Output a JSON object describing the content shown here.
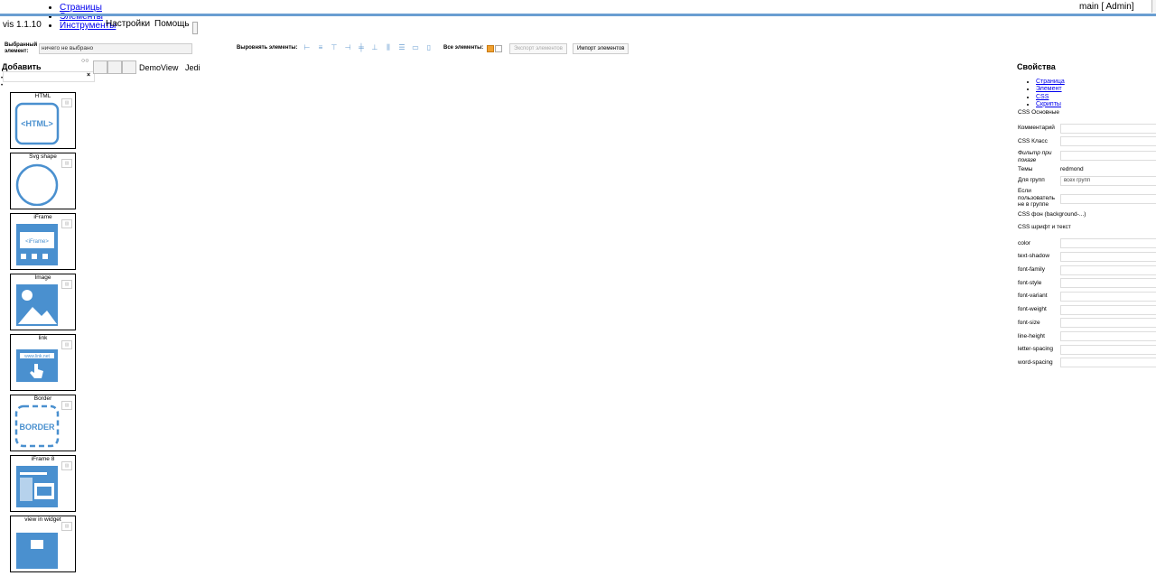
{
  "top_links": [
    "Страницы",
    "Элементы",
    "Инструменты"
  ],
  "app_version": "vis 1.1.10",
  "menu": {
    "settings": "Настройки",
    "help": "Помощь"
  },
  "user": "main [ Admin]",
  "toolbar": {
    "selected_label": "Выбранный элемент:",
    "selected_value": "ничего не выбрано",
    "align_label": "Выровнять элементы:",
    "all_label": "Все элементы:",
    "export_label": "Экспорт элементов",
    "import_label": "Импорт элементов",
    "export_enabled": false,
    "all_checked": true
  },
  "left": {
    "title": "Добавить",
    "search_icon": "glasses-icon",
    "close": "×",
    "widgets": [
      {
        "title": "HTML",
        "icon": "html-icon"
      },
      {
        "title": "Svg shape",
        "icon": "circle-icon"
      },
      {
        "title": "iFrame",
        "icon": "iframe-icon"
      },
      {
        "title": "Image",
        "icon": "image-icon"
      },
      {
        "title": "link",
        "icon": "link-icon"
      },
      {
        "title": "Border",
        "icon": "border-icon"
      },
      {
        "title": "iFrame 8",
        "icon": "iframe8-icon"
      },
      {
        "title": "view in widget",
        "icon": "view-icon"
      }
    ]
  },
  "views": [
    "DemoView",
    "Jedi"
  ],
  "properties": {
    "title": "Свойства",
    "links": [
      "Страница",
      "Элемент",
      "CSS",
      "Скрипты"
    ],
    "css_basic": "CSS Основные",
    "comment": "Комментарий",
    "css_class": "CSS Класс",
    "filter": "Фильтр при показе",
    "themes_label": "Темы",
    "themes_value": "redmond",
    "groups_label": "Для групп",
    "groups_value": "всех групп",
    "not_in_group": "Если пользователь не в группе",
    "css_bg": "CSS фон (background-...)",
    "css_font": "CSS шрифт и текст",
    "font_props": [
      "color",
      "text-shadow",
      "font-family",
      "font-style",
      "font-variant",
      "font-weight",
      "font-size",
      "line-height",
      "letter-spacing",
      "word-spacing"
    ]
  },
  "colors": {
    "accent": "#6a9ed1",
    "checkbox": "#f0a030"
  }
}
